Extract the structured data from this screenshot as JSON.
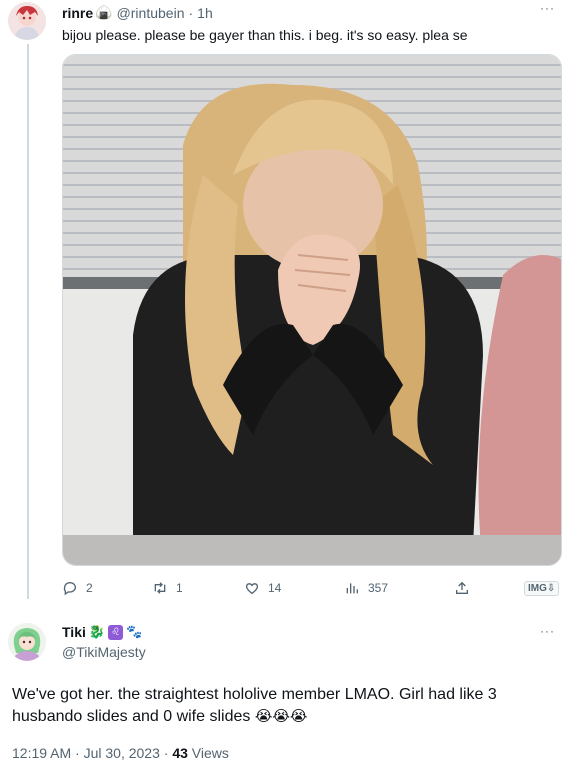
{
  "reply_tweet": {
    "display_name": "rinre",
    "name_emoji": "🍙",
    "handle": "@rintubein",
    "separator": "·",
    "time": "1h",
    "more_label": "···",
    "text": "bijou please. please be gayer than this. i beg. it's so easy. plea se",
    "actions": {
      "replies": "2",
      "retweets": "1",
      "likes": "14",
      "views": "357"
    },
    "media_badge": "IMG⇩"
  },
  "main_tweet": {
    "display_name": "Tiki",
    "name_emojis": [
      "🐉",
      "♌",
      "🐾"
    ],
    "handle": "@TikiMajesty",
    "more_label": "···",
    "text": "We've got her. the straightest hololive member LMAO. Girl had like 3 husbando slides and 0 wife slides",
    "text_emojis": "😭😭😭",
    "timestamp": "12:19 AM · Jul 30, 2023 · ",
    "views_count": "43",
    "views_label": " Views"
  },
  "colors": {
    "text_primary": "#0f1419",
    "text_secondary": "#536471",
    "border": "#cfd9de"
  },
  "icons": [
    "reply-icon",
    "retweet-icon",
    "like-icon",
    "views-icon",
    "share-icon",
    "more-icon"
  ]
}
